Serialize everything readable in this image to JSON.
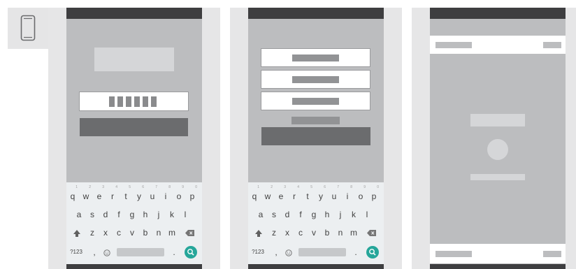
{
  "device_icon": "smartphone-icon",
  "keyboard": {
    "row1": [
      "q",
      "w",
      "e",
      "r",
      "t",
      "y",
      "u",
      "i",
      "o",
      "p"
    ],
    "row1_hints": [
      "1",
      "2",
      "3",
      "4",
      "5",
      "6",
      "7",
      "8",
      "9",
      "0"
    ],
    "row2": [
      "a",
      "s",
      "d",
      "f",
      "g",
      "h",
      "j",
      "k",
      "l"
    ],
    "row3": [
      "z",
      "x",
      "c",
      "v",
      "b",
      "n",
      "m"
    ],
    "symbols_key": "?123",
    "comma_key": ",",
    "period_key": ".",
    "icons": {
      "shift": "shift-arrow-icon",
      "backspace": "backspace-icon",
      "emoji": "emoji-icon",
      "enter": "search-enter-icon"
    }
  },
  "colors": {
    "accent": "#26a69a",
    "status_bar": "#3e3e40",
    "screen_bg": "#bcbdbf",
    "placeholder": "#929395",
    "button": "#6b6c6e"
  }
}
